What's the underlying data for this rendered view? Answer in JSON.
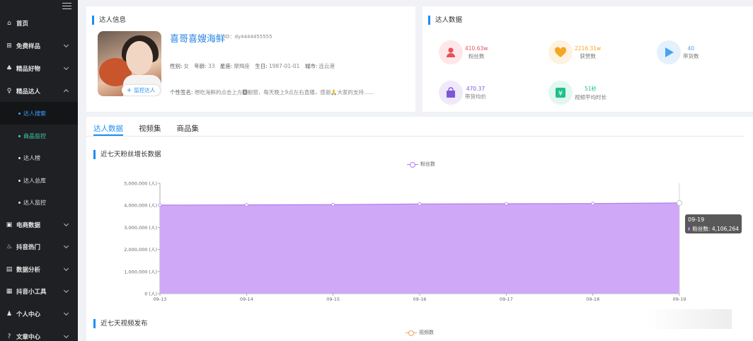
{
  "sidebar": {
    "items": [
      {
        "icon": "home-icon",
        "glyph": "⌂",
        "label": "首页",
        "expandable": false
      },
      {
        "icon": "gift-icon",
        "glyph": "⊞",
        "label": "免费样品",
        "expandable": true
      },
      {
        "icon": "thumb-icon",
        "glyph": "♣",
        "label": "精品好物",
        "expandable": true
      },
      {
        "icon": "user-icon",
        "glyph": "♀",
        "label": "精品达人",
        "expandable": true,
        "expanded": true
      },
      {
        "icon": "ecommerce-icon",
        "glyph": "▣",
        "label": "电商数据",
        "expandable": true
      },
      {
        "icon": "fire-icon",
        "glyph": "♨",
        "label": "抖音热门",
        "expandable": true
      },
      {
        "icon": "analysis-icon",
        "glyph": "▤",
        "label": "数据分析",
        "expandable": true
      },
      {
        "icon": "toolbox-icon",
        "glyph": "▦",
        "label": "抖音小工具",
        "expandable": true
      },
      {
        "icon": "person-icon",
        "glyph": "♟",
        "label": "个人中心",
        "expandable": true
      },
      {
        "icon": "help-icon",
        "glyph": "?",
        "label": "文章中心",
        "expandable": true
      }
    ],
    "subitems": [
      "达人搜索",
      "商品监控",
      "达人榜",
      "达人总库",
      "达人监控"
    ]
  },
  "profile": {
    "card_title": "达人信息",
    "name": "喜哥喜嫂海鲜",
    "id": "ID：dy4444455555",
    "monitor_label": "监控达人",
    "gender_label": "性别:",
    "gender": "女",
    "age_label": "年龄:",
    "age": "33",
    "zodiac_label": "星座:",
    "zodiac": "摩羯座",
    "birthday_label": "生日:",
    "birthday": "1987-01-01",
    "city_label": "城市:",
    "city": "连云港",
    "signature_label": "个性签名:",
    "signature": "想吃海鲜的点击上方🅰橱窗，每天晚上9点左右直播，感谢🙏大家的支持......"
  },
  "stats": {
    "card_title": "达人数据",
    "items": [
      {
        "icon": "fans-icon",
        "value": "410.63w",
        "label": "粉丝数",
        "color": "#e8505b",
        "bg": "#fde7e8"
      },
      {
        "icon": "likes-icon",
        "value": "2216.31w",
        "label": "获赞数",
        "color": "#f5a623",
        "bg": "#fef2e0"
      },
      {
        "icon": "play-icon",
        "value": "40",
        "label": "带货数",
        "color": "#4aa3f0",
        "bg": "#e4f1fd"
      },
      {
        "icon": "bag-icon",
        "value": "470.37",
        "label": "带货均价",
        "color": "#7d57d9",
        "bg": "#efe9fb"
      },
      {
        "icon": "duration-icon",
        "value": "51秒",
        "label": "视频平均时长",
        "color": "#1fbf8f",
        "bg": "#e1f7ef"
      }
    ]
  },
  "tabs": [
    {
      "label": "达人数据",
      "active": true
    },
    {
      "label": "视频集",
      "active": false
    },
    {
      "label": "商品集",
      "active": false
    }
  ],
  "fans_section": {
    "title": "近七天粉丝增长数据",
    "legend": "粉丝数",
    "legend_color": "#b57af0",
    "tooltip_date": "09-19",
    "tooltip_label": "粉丝数: 4,106,264"
  },
  "video_section": {
    "title": "近七天视频发布",
    "legend": "视频数",
    "legend_color": "#f0a35a"
  },
  "chart_data": {
    "type": "area",
    "x": [
      "09-13",
      "09-14",
      "09-15",
      "09-16",
      "09-17",
      "09-18",
      "09-19"
    ],
    "series": [
      {
        "name": "粉丝数",
        "values": [
          4010000,
          4020000,
          4030000,
          4060000,
          4070000,
          4080000,
          4106264
        ]
      }
    ],
    "yticks": [
      "0 (人)",
      "1,000,000 (人)",
      "2,000,000 (人)",
      "3,000,000 (人)",
      "4,000,000 (人)",
      "5,000,000 (人)"
    ],
    "ylim": [
      0,
      5000000
    ],
    "fill_color": "#cfa9f7",
    "line_color": "#b57af0"
  }
}
